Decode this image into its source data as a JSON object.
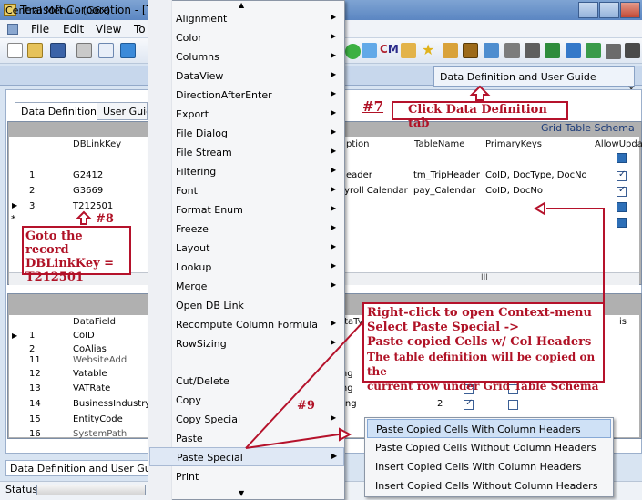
{
  "window": {
    "title": "Terasoft Corporation - [T10"
  },
  "menubar": {
    "file": "File",
    "edit": "Edit",
    "view": "View",
    "more": "To"
  },
  "tabs": {
    "central_menu": "Central Menu - (G6x)",
    "data_definition_user_guide": "Data Definition and User Guide",
    "inner_data_definition": "Data Definition",
    "inner_user_guide": "User Guid"
  },
  "grid_top": {
    "title": "Grid Table Schema",
    "headers": {
      "dblinkkey": "DBLinkKey",
      "caption": "ption",
      "tablename": "TableName",
      "primarykeys": "PrimaryKeys",
      "allowupdate": "AllowUpdat"
    },
    "rows": [
      {
        "num": "1",
        "key": "G2412",
        "caption": "eader",
        "table": "tm_TripHeader",
        "pk": "CoID, DocType, DocNo"
      },
      {
        "num": "2",
        "key": "G3669",
        "caption": "ayroll Calendar",
        "table": "pay_Calendar",
        "pk": "CoID, DocNo"
      },
      {
        "num": "3",
        "key": "T212501"
      }
    ],
    "splitter": "III"
  },
  "grid_bottom": {
    "headers": {
      "datafield": "DataField",
      "datatype": "ataTy",
      "extra": "is"
    },
    "rows": [
      {
        "num": "1",
        "field": "CoID"
      },
      {
        "num": "2",
        "field": "CoAlias"
      },
      {
        "num": "11",
        "field": "WebsiteAdd"
      },
      {
        "num": "12",
        "field": "Vatable"
      },
      {
        "num": "13",
        "field": "VATRate"
      },
      {
        "num": "14",
        "field": "BusinessIndustryG"
      },
      {
        "num": "15",
        "field": "EntityCode"
      },
      {
        "num": "16",
        "field": "SystemPath"
      }
    ],
    "types": [
      "ring",
      "ring",
      "ouble",
      "ring"
    ],
    "value_2": "2"
  },
  "context_menu": {
    "items": [
      "Alignment",
      "Color",
      "Columns",
      "DataView",
      "DirectionAfterEnter",
      "Export",
      "File Dialog",
      "File Stream",
      "Filtering",
      "Font",
      "Format Enum",
      "Freeze",
      "Layout",
      "Lookup",
      "Merge",
      "Open DB Link",
      "Recompute Column Formula",
      "RowSizing",
      "Cut/Delete",
      "Copy",
      "Copy Special",
      "Paste",
      "Paste Special",
      "Print"
    ]
  },
  "submenu": {
    "items": [
      "Paste Copied Cells With Column Headers",
      "Paste Copied Cells Without Column Headers",
      "Insert Copied Cells With Column Headers",
      "Insert Copied Cells Without Column Headers"
    ]
  },
  "annotations": {
    "n7": "#7",
    "n7_text": "Click Data Definition tab",
    "n8": "#8",
    "n8_line1": "Goto the record",
    "n8_line2": "DBLinkKey =",
    "n8_line3": "T212501",
    "n9": "#9",
    "n9_line1": "Right-click to open Context-menu",
    "n9_line2": "Select Paste Special ->",
    "n9_line3": "Paste copied Cells w/ Col Headers",
    "n9_line4": "The table definition will be copied on the",
    "n9_line5": "current row under Grid Table Schema"
  },
  "bottom": {
    "doc_tab": "Data Definition and User Guide [G",
    "status": "Status"
  },
  "colors": {
    "annotation_red": "#b5122b",
    "highlight": "#cfe1f6"
  }
}
